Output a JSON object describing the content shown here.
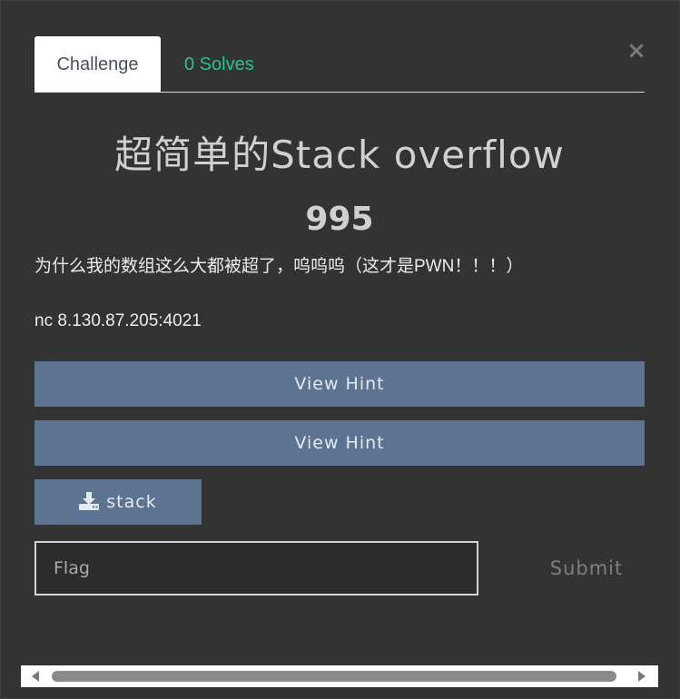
{
  "modal": {
    "close_label": "×"
  },
  "tabs": [
    {
      "label": "Challenge"
    },
    {
      "label": "0 Solves"
    }
  ],
  "challenge": {
    "name": "超简单的Stack overflow",
    "value": "995",
    "description": "为什么我的数组这么大都被超了，呜呜呜（这才是PWN！！！）",
    "connection": "nc 8.130.87.205:4021"
  },
  "hints": [
    {
      "label": "View Hint"
    },
    {
      "label": "View Hint"
    }
  ],
  "files": [
    {
      "label": "stack",
      "icon": "download-icon"
    }
  ],
  "submission": {
    "placeholder": "Flag",
    "submit_label": "Submit"
  },
  "colors": {
    "background": "#333333",
    "button": "#5c7492",
    "solves_accent": "#2dc18f"
  }
}
